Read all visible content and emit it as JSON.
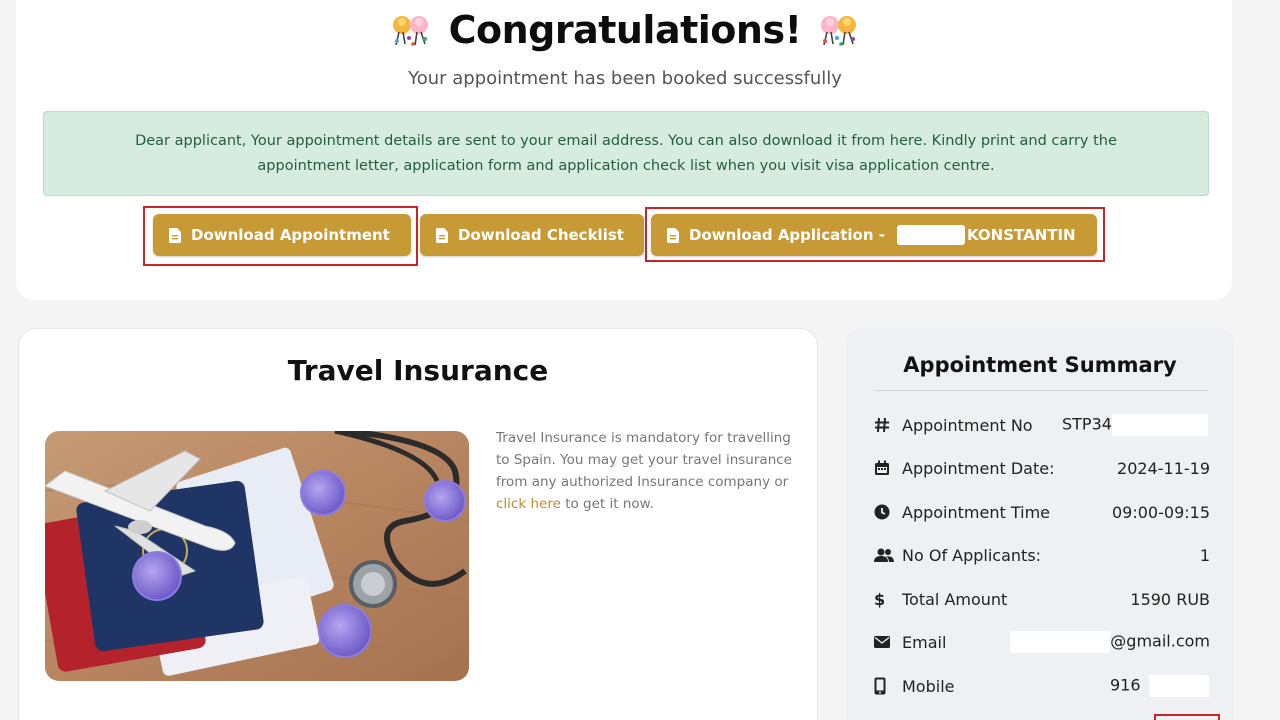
{
  "header": {
    "title": "Congratulations!",
    "subtitle": "Your appointment has been booked successfully"
  },
  "notice": {
    "text": "Dear applicant, Your appointment details are sent to your email address. You can also download it from here. Kindly print and carry the appointment letter, application form and application check list when you visit visa application centre."
  },
  "buttons": {
    "download_appointment": "Download Appointment",
    "download_checklist": "Download Checklist",
    "download_application_prefix": "Download Application -",
    "download_application_name": "KONSTANTIN"
  },
  "insurance": {
    "title": "Travel Insurance",
    "text_before_link": "Travel Insurance is mandatory for travelling to Spain. You may get your travel insurance from any authorized Insurance company or",
    "link_text": "click here",
    "text_after_link": "to get it now."
  },
  "summary": {
    "title": "Appointment Summary",
    "rows": [
      {
        "label": "Appointment No",
        "value": "STP34",
        "icon": "hash-icon"
      },
      {
        "label": "Appointment Date:",
        "value": "2024-11-19",
        "icon": "calendar-icon"
      },
      {
        "label": "Appointment Time",
        "value": "09:00-09:15",
        "icon": "clock-icon"
      },
      {
        "label": "No Of Applicants:",
        "value": "1",
        "icon": "users-icon"
      },
      {
        "label": "Total Amount",
        "value": "1590 RUB",
        "icon": "dollar-icon"
      },
      {
        "label": "Email",
        "value": "@gmail.com",
        "icon": "envelope-icon"
      },
      {
        "label": "Mobile",
        "value": "916",
        "icon": "mobile-icon"
      }
    ]
  },
  "colors": {
    "button_gold": "#c79a35",
    "notice_bg": "#d6ece0",
    "notice_text": "#245e3d",
    "highlight_red": "#c6252b",
    "link_gold": "#b9902f"
  }
}
